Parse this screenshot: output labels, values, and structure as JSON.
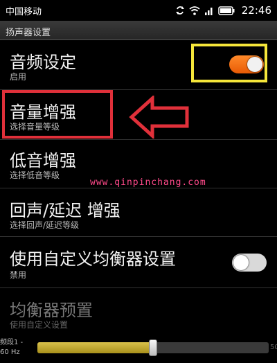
{
  "status_bar": {
    "carrier": "中国移动",
    "time": "22:46",
    "icons": [
      "sync-icon",
      "wifi-icon",
      "signal-icon",
      "battery-icon"
    ]
  },
  "header": {
    "title": "扬声器设置"
  },
  "settings": [
    {
      "title": "音频设定",
      "subtitle": "启用",
      "toggle": "on"
    },
    {
      "title": "音量增强",
      "subtitle": "选择音量等级"
    },
    {
      "title": "低音增强",
      "subtitle": "选择低音等级"
    },
    {
      "title": "回声/延迟 增强",
      "subtitle": "选择回声/延迟等级"
    },
    {
      "title": "使用自定义均衡器设置",
      "subtitle": "禁用",
      "toggle": "off"
    },
    {
      "title": "均衡器预置",
      "subtitle": "使用自定义设置",
      "disabled": true
    }
  ],
  "slider": {
    "band_label_line1": "频段1 -",
    "band_label_line2": "60 Hz",
    "end_label": "50",
    "value_fraction": 0.5
  },
  "watermark": "www.qinpinchang.com",
  "colors": {
    "toggle_on": "#f26b12",
    "annotation_yellow": "#f5e63a",
    "annotation_red": "#e0303a",
    "slider_fill": "#c0a832"
  }
}
